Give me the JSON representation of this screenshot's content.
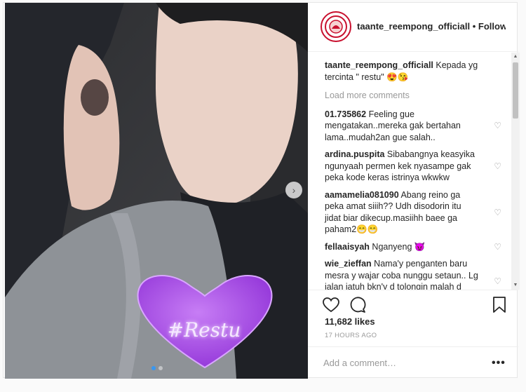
{
  "header": {
    "username": "taante_reempong_officiall",
    "separator": "•",
    "follow_status": "Following"
  },
  "media": {
    "sticker_text": "#Restu",
    "slide_count": 2,
    "active_slide": 1
  },
  "caption": {
    "username": "taante_reempong_officiall",
    "text": "Kepada yg tercinta \" restu\" 😍😘"
  },
  "load_more_label": "Load more comments",
  "comments": [
    {
      "username": "01.735862",
      "text": "Feeling gue mengatakan..mereka gak bertahan lama..mudah2an gue salah.."
    },
    {
      "username": "ardina.puspita",
      "text": "Sibabangnya keasyika ngunyaah permen kek nyasampe gak peka kode keras istrinya wkwkw"
    },
    {
      "username": "aamamelia081090",
      "text": "Abang reino ga peka amat siiih?? Udh disodorin itu jidat biar dikecup.masiihh baee ga paham2😁😁"
    },
    {
      "username": "fellaaisyah",
      "text": "Nganyeng 😈"
    },
    {
      "username": "wie_zieffan",
      "text": "Nama'y penganten baru mesra y wajar coba nunggu setaun.. Lg jalan jatuh bkn'y d tolongin malah d katain maka'y klo jalan pke mata 😅😅"
    }
  ],
  "likes": "11,682 likes",
  "timestamp": "17 HOURS AGO",
  "add_comment_placeholder": "Add a comment…",
  "more_label": "•••",
  "colors": {
    "accent": "#3897f0",
    "sticker_heart": "#a64ce6",
    "avatar_ring": "#c8102e"
  },
  "icons": {
    "like": "heart-icon",
    "comment": "comment-bubble-icon",
    "save": "bookmark-icon",
    "next": "chevron-right-icon"
  }
}
